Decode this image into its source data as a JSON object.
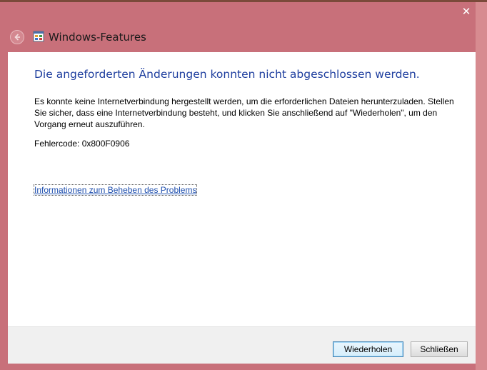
{
  "window": {
    "title": "Windows-Features",
    "close_glyph": "✕",
    "accent_color": "#c8707a"
  },
  "content": {
    "heading": "Die angeforderten Änderungen konnten nicht abgeschlossen werden.",
    "message": "Es konnte keine Internetverbindung hergestellt werden, um die erforderlichen Dateien herunterzuladen. Stellen Sie sicher, dass eine Internetverbindung besteht, und klicken Sie anschließend auf \"Wiederholen\", um den Vorgang erneut auszuführen.",
    "error_code": "Fehlercode: 0x800F0906",
    "help_link": "Informationen zum Beheben des Problems"
  },
  "footer": {
    "retry_label": "Wiederholen",
    "close_label": "Schließen"
  },
  "icons": {
    "back": "back-arrow-icon",
    "app": "windows-features-icon",
    "close": "close-icon"
  }
}
